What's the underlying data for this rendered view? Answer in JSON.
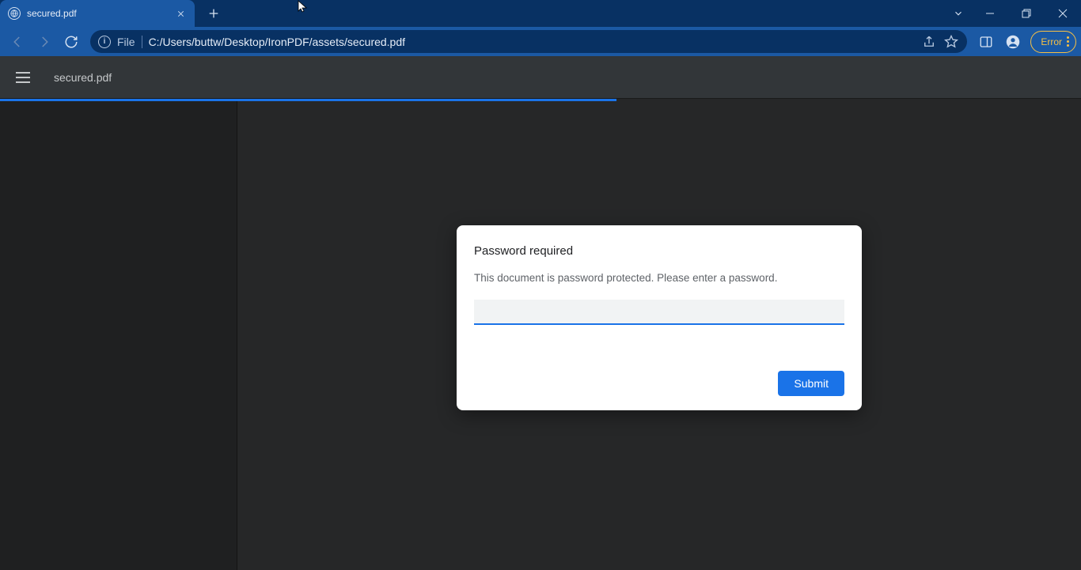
{
  "tab": {
    "title": "secured.pdf"
  },
  "address": {
    "file_label": "File",
    "url": "C:/Users/buttw/Desktop/IronPDF/assets/secured.pdf"
  },
  "toolbar": {
    "error_label": "Error"
  },
  "pdf": {
    "filename": "secured.pdf"
  },
  "dialog": {
    "title": "Password required",
    "message": "This document is password protected. Please enter a password.",
    "submit_label": "Submit"
  }
}
